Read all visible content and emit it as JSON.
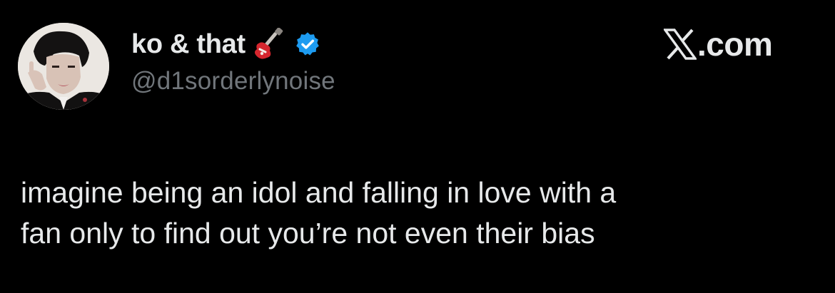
{
  "author": {
    "display_name": "ko & that",
    "name_emoji_icon": "electric-guitar-icon",
    "verified_icon": "verified-badge-icon",
    "handle": "@d1sorderlynoise",
    "avatar_icon": "profile-photo"
  },
  "brand": {
    "logo_icon": "x-logo-icon",
    "text": ".com"
  },
  "tweet": {
    "lines": [
      "imagine being an idol and falling in love with a",
      "fan only to find out you’re not even their bias"
    ]
  },
  "colors": {
    "background": "#000000",
    "primary_text": "#e7e9ea",
    "secondary_text": "#71767b",
    "verified": "#1d9bf0"
  }
}
